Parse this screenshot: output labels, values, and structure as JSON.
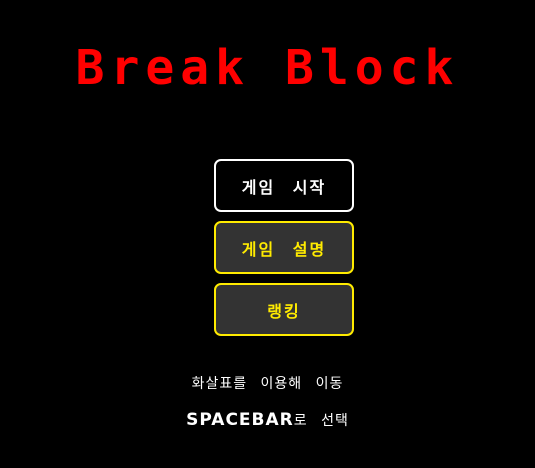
{
  "game": {
    "title": "Break Block",
    "title_color": "#FF0000"
  },
  "menu": {
    "items": [
      {
        "label": "게임 시작",
        "selected": true
      },
      {
        "label": "게임 설명",
        "selected": false
      },
      {
        "label": "랭킹",
        "selected": false
      }
    ],
    "selected_color": "#FFFFFF",
    "unselected_color": "#FFEB00",
    "unselected_bg": "#333333"
  },
  "hints": {
    "move": "화살표를 이용해 이동",
    "select_key": "SPACEBAR",
    "select_text": "로 선택"
  }
}
